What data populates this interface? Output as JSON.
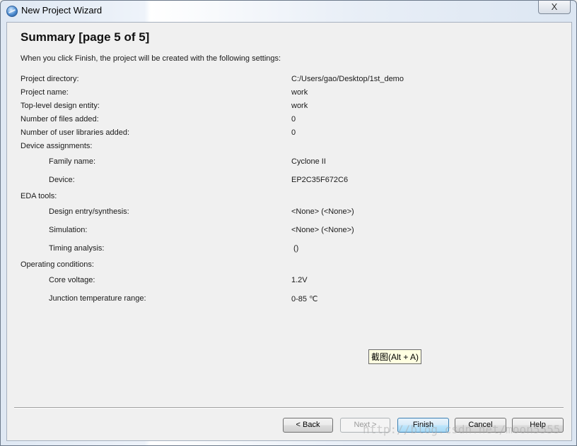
{
  "window": {
    "title": "New Project Wizard",
    "close_glyph": "X"
  },
  "page": {
    "heading": "Summary [page 5 of 5]",
    "intro": "When you click Finish, the project will be created with the following settings:"
  },
  "settings": [
    {
      "label": "Project directory:",
      "value": "C:/Users/gao/Desktop/1st_demo"
    },
    {
      "label": "Project name:",
      "value": "work"
    },
    {
      "label": "Top-level design entity:",
      "value": "work"
    },
    {
      "label": "Number of files added:",
      "value": "0"
    },
    {
      "label": "Number of user libraries added:",
      "value": "0"
    },
    {
      "label": "Device assignments:",
      "value": ""
    },
    {
      "label": "Family name:",
      "value": "Cyclone II"
    },
    {
      "label": "Device:",
      "value": "EP2C35F672C6"
    },
    {
      "label": "EDA tools:",
      "value": ""
    },
    {
      "label": "Design entry/synthesis:",
      "value": "<None> (<None>)"
    },
    {
      "label": "Simulation:",
      "value": "<None> (<None>)"
    },
    {
      "label": "Timing analysis:",
      "value": "()"
    },
    {
      "label": "Operating conditions:",
      "value": ""
    },
    {
      "label": "Core voltage:",
      "value": "1.2V"
    },
    {
      "label": "Junction temperature range:",
      "value": "0-85 ℃"
    }
  ],
  "tooltip": "截图(Alt + A)",
  "buttons": {
    "back": "< Back",
    "next": "Next >",
    "finish": "Finish",
    "cancel": "Cancel",
    "help": "Help"
  },
  "watermark": "http://blog.csdn.net/moon5555"
}
